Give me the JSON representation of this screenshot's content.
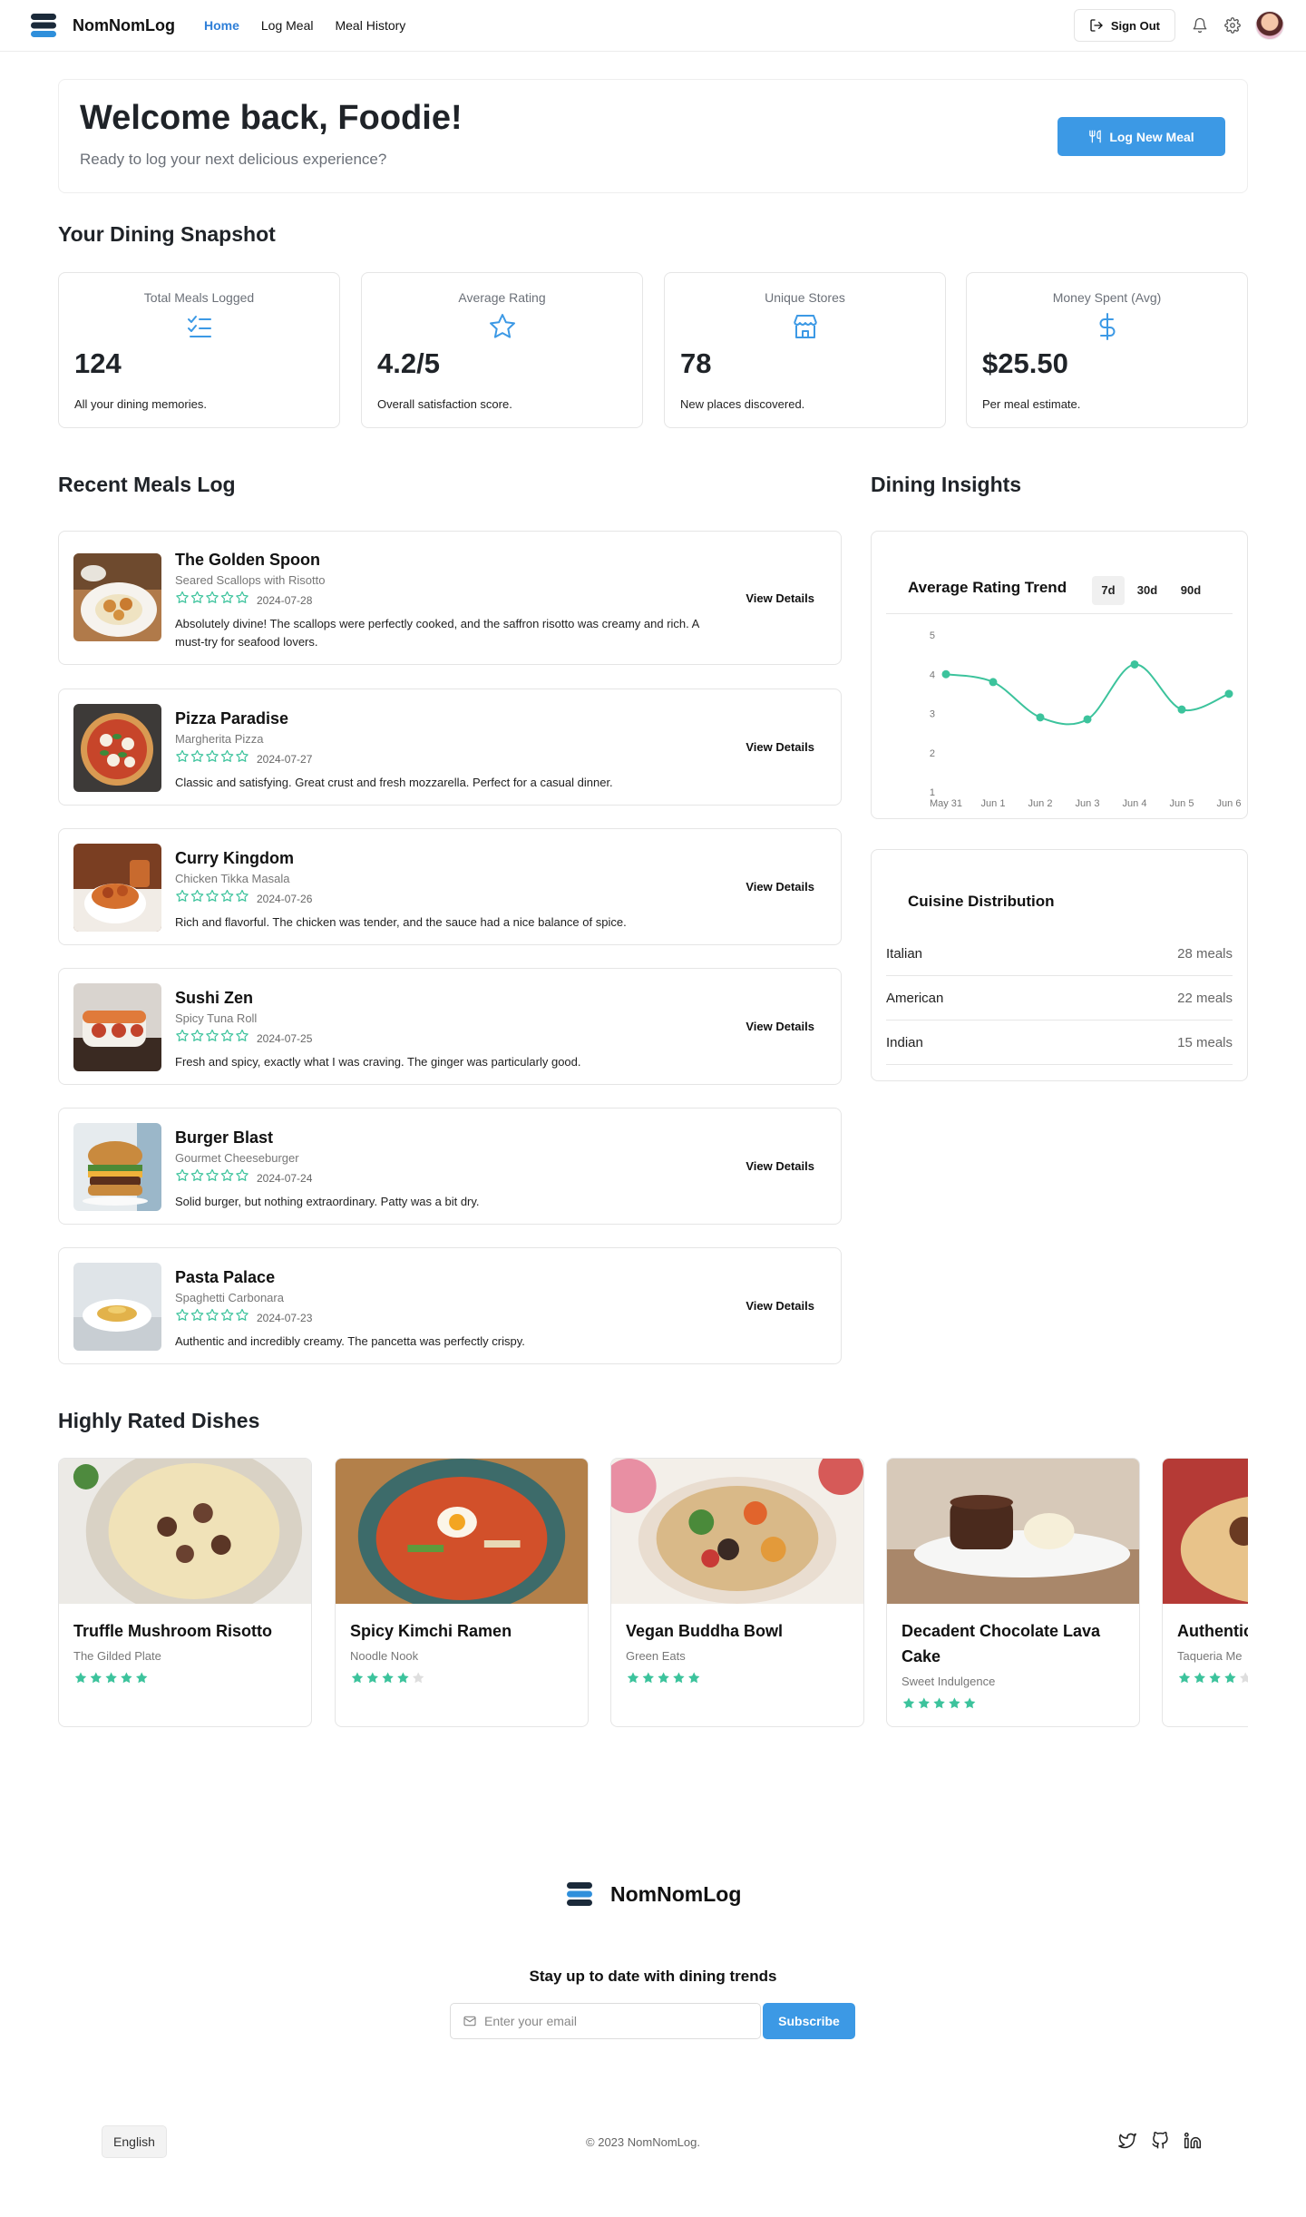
{
  "nav": {
    "brand": "NomNomLog",
    "links": [
      "Home",
      "Log Meal",
      "Meal History"
    ],
    "active": "Home",
    "signout_label": "Sign Out"
  },
  "welcome": {
    "title": "Welcome back, Foodie!",
    "subtitle": "Ready to log your next delicious experience?",
    "cta_label": "Log New Meal"
  },
  "snapshot": {
    "title": "Your Dining Snapshot",
    "stats": [
      {
        "label": "Total Meals Logged",
        "value": "124",
        "sub": "All your dining memories.",
        "icon": "checklist-icon"
      },
      {
        "label": "Average Rating",
        "value": "4.2/5",
        "sub": "Overall satisfaction score.",
        "icon": "star-icon"
      },
      {
        "label": "Unique Stores",
        "value": "78",
        "sub": "New places discovered.",
        "icon": "store-icon"
      },
      {
        "label": "Money Spent (Avg)",
        "value": "$25.50",
        "sub": "Per meal estimate.",
        "icon": "dollar-icon"
      }
    ]
  },
  "recent": {
    "title": "Recent Meals Log",
    "details_label": "View Details",
    "meals": [
      {
        "store": "The Golden Spoon",
        "dish": "Seared Scallops with Risotto",
        "date": "2024-07-28",
        "note": "Absolutely divine! The scallops were perfectly cooked, and the saffron risotto was creamy and rich. A must-try for seafood lovers."
      },
      {
        "store": "Pizza Paradise",
        "dish": "Margherita Pizza",
        "date": "2024-07-27",
        "note": "Classic and satisfying. Great crust and fresh mozzarella. Perfect for a casual dinner."
      },
      {
        "store": "Curry Kingdom",
        "dish": "Chicken Tikka Masala",
        "date": "2024-07-26",
        "note": "Rich and flavorful. The chicken was tender, and the sauce had a nice balance of spice."
      },
      {
        "store": "Sushi Zen",
        "dish": "Spicy Tuna Roll",
        "date": "2024-07-25",
        "note": "Fresh and spicy, exactly what I was craving. The ginger was particularly good."
      },
      {
        "store": "Burger Blast",
        "dish": "Gourmet Cheeseburger",
        "date": "2024-07-24",
        "note": "Solid burger, but nothing extraordinary. Patty was a bit dry."
      },
      {
        "store": "Pasta Palace",
        "dish": "Spaghetti Carbonara",
        "date": "2024-07-23",
        "note": "Authentic and incredibly creamy. The pancetta was perfectly crispy."
      }
    ]
  },
  "insights": {
    "title": "Dining Insights",
    "trend_title": "Average Rating Trend",
    "ranges": [
      "7d",
      "30d",
      "90d"
    ],
    "active_range": "7d",
    "cuisine_title": "Cuisine Distribution",
    "cuisines": [
      {
        "name": "Italian",
        "count": "28 meals"
      },
      {
        "name": "American",
        "count": "22 meals"
      },
      {
        "name": "Indian",
        "count": "15 meals"
      }
    ]
  },
  "chart_data": {
    "type": "line",
    "title": "Average Rating Trend",
    "x": [
      "May 31",
      "Jun 1",
      "Jun 2",
      "Jun 3",
      "Jun 4",
      "Jun 5",
      "Jun 6"
    ],
    "series": [
      {
        "values": [
          4.0,
          3.8,
          2.9,
          2.85,
          4.25,
          3.1,
          3.5
        ]
      }
    ],
    "yticks": [
      "1",
      "2",
      "3",
      "4",
      "5"
    ],
    "ylim": [
      1,
      5
    ],
    "line_color": "#3cc39c",
    "grid": false
  },
  "highly_rated": {
    "title": "Highly Rated Dishes",
    "dishes": [
      {
        "name": "Truffle Mushroom Risotto",
        "store": "The Gilded Plate",
        "stars": 5
      },
      {
        "name": "Spicy Kimchi Ramen",
        "store": "Noodle Nook",
        "stars": 4
      },
      {
        "name": "Vegan Buddha Bowl",
        "store": "Green Eats",
        "stars": 5
      },
      {
        "name": "Decadent Chocolate Lava Cake",
        "store": "Sweet Indulgence",
        "stars": 5
      },
      {
        "name": "Authentic",
        "store": "Taqueria Me",
        "stars": 4
      }
    ]
  },
  "footer": {
    "brand": "NomNomLog",
    "subscribe_title": "Stay up to date with dining trends",
    "email_placeholder": "Enter your email",
    "subscribe_label": "Subscribe",
    "language": "English",
    "copyright": "© 2023 NomNomLog."
  },
  "colors": {
    "accent": "#3c99e5",
    "star": "#3cc39c",
    "brand_dark": "#1b2a3a",
    "brand_blue": "#2f8fdb"
  }
}
